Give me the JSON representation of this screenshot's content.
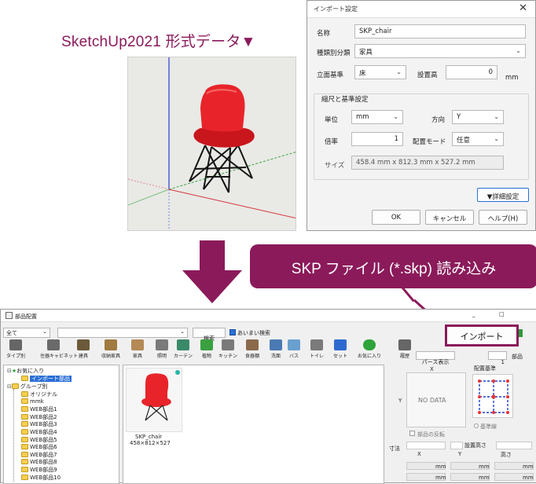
{
  "caption_top": "SketchUp2021 形式データ▼",
  "dialog": {
    "title": "インポート設定",
    "close": "✕",
    "name_label": "名称",
    "name_value": "SKP_chair",
    "category_label": "種類別分類",
    "category_value": "家具",
    "level_ref_label": "立面基準",
    "level_ref_value": "床",
    "install_height_label": "設置高",
    "install_height_value": "0",
    "install_height_unit": "mm",
    "scale_group_title": "縮尺と基準設定",
    "unit_label": "単位",
    "unit_value": "mm",
    "direction_label": "方向",
    "direction_value": "Y",
    "factor_label": "倍率",
    "factor_value": "1",
    "placement_mode_label": "配置モード",
    "placement_mode_value": "任意",
    "size_label": "サイズ",
    "size_value": "458.4 mm x 812.3 mm x 527.2 mm",
    "detail_button": "▼詳細設定",
    "ok_button": "OK",
    "cancel_button": "キャンセル",
    "help_button": "ヘルプ(H)"
  },
  "banner": "SKP ファイル (*.skp) 読み込み",
  "parts_window": {
    "title": "部品配置",
    "win_min": "_",
    "win_max": "□",
    "filter_value": "全て",
    "search_button": "検索",
    "fuzzy_label": "あいまい検索",
    "import_button": "インポート",
    "toolbar": [
      {
        "label": "タイプ別",
        "icon": "type-icon"
      },
      {
        "label": "住器キャビネット",
        "icon": "cabinet-icon"
      },
      {
        "label": "建具",
        "icon": "fitting-icon"
      },
      {
        "label": "収納家具",
        "icon": "storage-icon"
      },
      {
        "label": "家具",
        "icon": "furniture-icon"
      },
      {
        "label": "照明",
        "icon": "lighting-icon"
      },
      {
        "label": "カーテン",
        "icon": "curtain-icon"
      },
      {
        "label": "植物",
        "icon": "plant-icon"
      },
      {
        "label": "キッチン",
        "icon": "kitchen-icon"
      },
      {
        "label": "食器棚",
        "icon": "cupboard-icon"
      },
      {
        "label": "洗面",
        "icon": "washbasin-icon"
      },
      {
        "label": "バス",
        "icon": "bath-icon"
      },
      {
        "label": "トイレ",
        "icon": "toilet-icon"
      },
      {
        "label": "セット",
        "icon": "set-icon"
      },
      {
        "label": "お気に入り",
        "icon": "favorite-icon"
      },
      {
        "label": "履歴",
        "icon": "history-icon"
      }
    ],
    "tree": {
      "favorites": "お気に入り",
      "import_parts": "インポート部品",
      "by_group": "グループ別",
      "original": "オリジナル",
      "mmk": "mmk",
      "web_items": [
        "WEB部品1",
        "WEB部品2",
        "WEB部品3",
        "WEB部品4",
        "WEB部品5",
        "WEB部品6",
        "WEB部品7",
        "WEB部品8",
        "WEB部品9",
        "WEB部品10"
      ]
    },
    "part_name": "SKP_chair",
    "part_size": "458×812×527",
    "parse_button": "パース表示",
    "count_value": "1",
    "count_unit": "部品",
    "x_label": "X",
    "y_label": "Y",
    "no_data": "NO DATA",
    "flip_label": "部品の反転",
    "placement_ref_label": "配置基準",
    "base_point_label": "基準線",
    "bottom": {
      "dim_label": "寸法",
      "height_label": "設置高さ",
      "x": "X",
      "y": "Y",
      "h": "高さ",
      "mm": "mm"
    }
  }
}
